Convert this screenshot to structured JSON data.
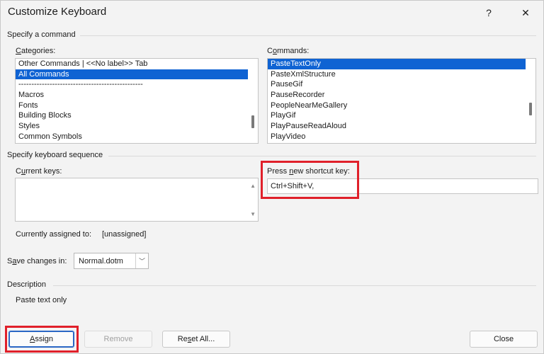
{
  "window": {
    "title": "Customize Keyboard",
    "help_glyph": "?",
    "close_glyph": "✕"
  },
  "command_group": {
    "label": "Specify a command",
    "categories_label": "Categories:",
    "commands_label": "Commands:",
    "categories": [
      {
        "label": "Other Commands | <<No label>> Tab",
        "selected": false
      },
      {
        "label": "All Commands",
        "selected": true
      },
      {
        "label": "------------------------------------------------",
        "selected": false
      },
      {
        "label": "Macros",
        "selected": false
      },
      {
        "label": "Fonts",
        "selected": false
      },
      {
        "label": "Building Blocks",
        "selected": false
      },
      {
        "label": "Styles",
        "selected": false
      },
      {
        "label": "Common Symbols",
        "selected": false
      }
    ],
    "commands": [
      {
        "label": "PasteTextOnly",
        "selected": true
      },
      {
        "label": "PasteXmlStructure",
        "selected": false
      },
      {
        "label": "PauseGif",
        "selected": false
      },
      {
        "label": "PauseRecorder",
        "selected": false
      },
      {
        "label": "PeopleNearMeGallery",
        "selected": false
      },
      {
        "label": "PlayGif",
        "selected": false
      },
      {
        "label": "PlayPauseReadAloud",
        "selected": false
      },
      {
        "label": "PlayVideo",
        "selected": false
      }
    ]
  },
  "keyboard_group": {
    "label": "Specify keyboard sequence",
    "current_keys_label": "Current keys:",
    "press_new_label": "Press new shortcut key:",
    "shortcut_value": "Ctrl+Shift+V,",
    "assigned_label": "Currently assigned to:",
    "assigned_value": "[unassigned]"
  },
  "save_changes": {
    "label": "Save changes in:",
    "value": "Normal.dotm"
  },
  "description": {
    "label": "Description",
    "text": "Paste text only"
  },
  "buttons": {
    "assign": "Assign",
    "remove": "Remove",
    "reset_all": "Reset All...",
    "close": "Close"
  },
  "colors": {
    "accent": "#0f63d3",
    "highlight": "#e0202a"
  }
}
